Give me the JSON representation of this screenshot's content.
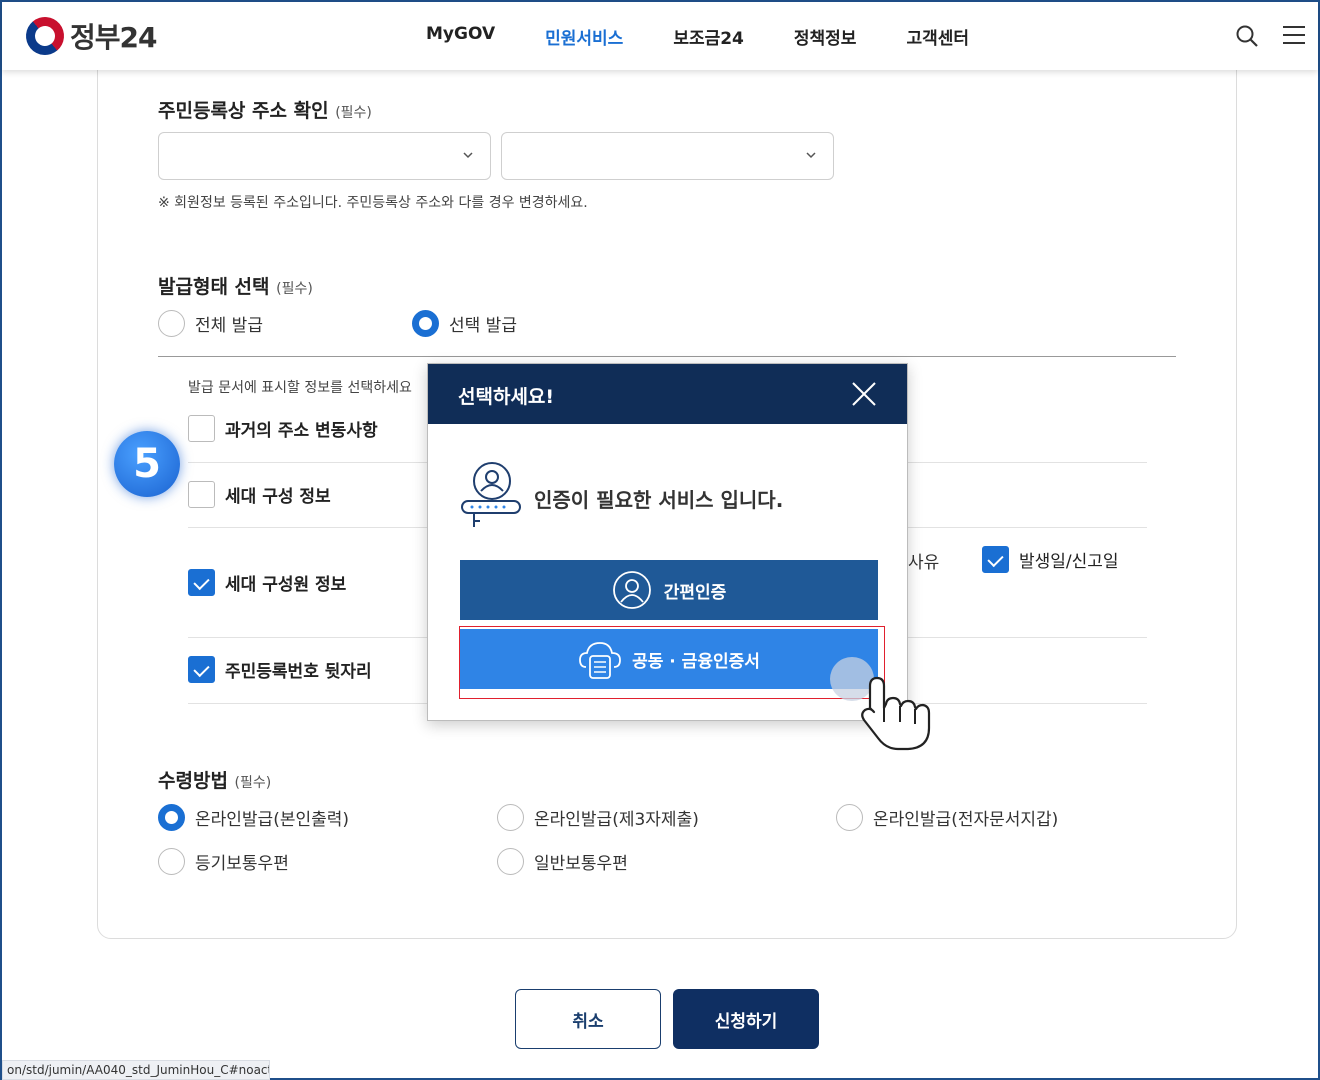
{
  "header": {
    "logo_text": "정부24",
    "nav": [
      "MyGOV",
      "민원서비스",
      "보조금24",
      "정책정보",
      "고객센터"
    ],
    "active_nav": "민원서비스"
  },
  "address": {
    "title": "주민등록상 주소 확인",
    "required": "(필수)",
    "note": "※ 회원정보 등록된 주소입니다. 주민등록상 주소와 다를 경우 변경하세요."
  },
  "issue_type": {
    "title": "발급형태 선택",
    "required": "(필수)",
    "options": [
      "전체 발급",
      "선택 발급"
    ],
    "selected": "선택 발급"
  },
  "info_select": {
    "instruction": "발급 문서에 표시할 정보를 선택하세요",
    "items": [
      {
        "label": "과거의 주소 변동사항",
        "checked": false
      },
      {
        "label": "세대 구성 정보",
        "checked": false
      },
      {
        "label": "세대 구성원 정보",
        "checked": true
      },
      {
        "label": "주민등록번호 뒷자리",
        "checked": true
      }
    ],
    "partial_label": "사유",
    "extra_option": {
      "label": "발생일/신고일",
      "checked": true
    }
  },
  "step_badge": "5",
  "receive": {
    "title": "수령방법",
    "required": "(필수)",
    "options": [
      "온라인발급(본인출력)",
      "온라인발급(제3자제출)",
      "온라인발급(전자문서지갑)",
      "등기보통우편",
      "일반보통우편"
    ],
    "selected": "온라인발급(본인출력)"
  },
  "buttons": {
    "cancel": "취소",
    "apply": "신청하기"
  },
  "statusbar": "on/std/jumin/AA040_std_JuminHou_C#noaction",
  "modal": {
    "title": "선택하세요!",
    "message": "인증이 필요한 서비스 입니다.",
    "simple_auth": "간편인증",
    "cert_auth": "공동 · 금융인증서"
  },
  "colors": {
    "primary": "#1a6fd3",
    "navy": "#102d57",
    "cert_blue": "#2f84e6",
    "simple_blue": "#1f5997"
  }
}
